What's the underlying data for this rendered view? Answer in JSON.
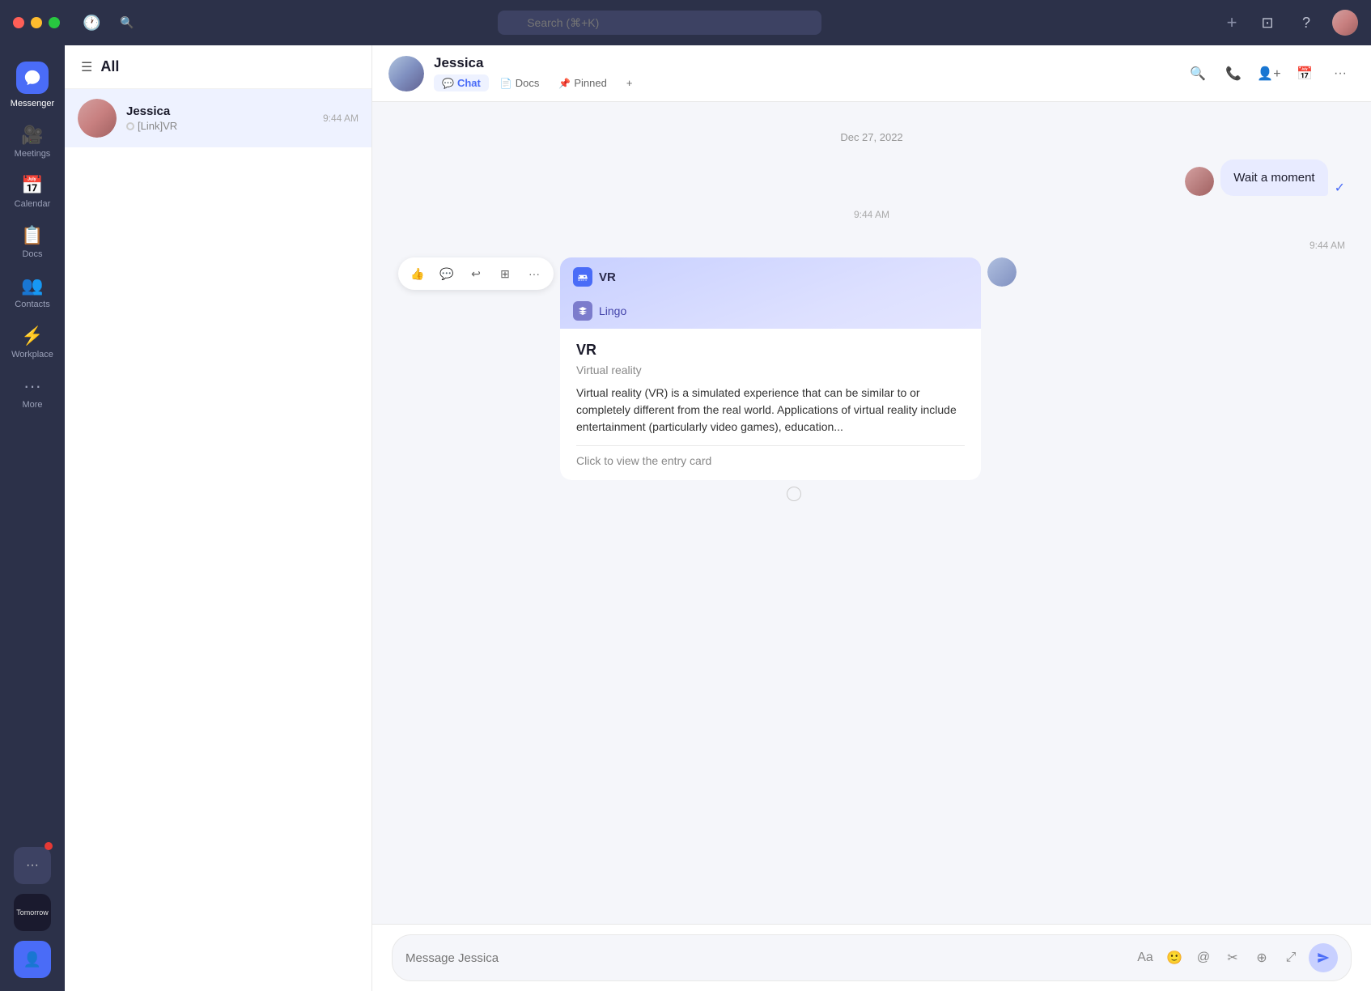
{
  "titlebar": {
    "search_placeholder": "Search (⌘+K)",
    "add_label": "+",
    "icons": [
      "screen-share",
      "help",
      "avatar"
    ]
  },
  "sidebar": {
    "items": [
      {
        "id": "messenger",
        "label": "Messenger",
        "active": true
      },
      {
        "id": "meetings",
        "label": "Meetings"
      },
      {
        "id": "calendar",
        "label": "Calendar"
      },
      {
        "id": "docs",
        "label": "Docs"
      },
      {
        "id": "contacts",
        "label": "Contacts"
      },
      {
        "id": "workplace",
        "label": "Workplace"
      },
      {
        "id": "more",
        "label": "More"
      }
    ]
  },
  "conversations": {
    "header": "All",
    "items": [
      {
        "name": "Jessica",
        "time": "9:44 AM",
        "preview": "[Link]VR"
      }
    ]
  },
  "chat": {
    "contact_name": "Jessica",
    "tabs": [
      {
        "id": "chat",
        "label": "Chat",
        "active": true,
        "icon": "💬"
      },
      {
        "id": "docs",
        "label": "Docs",
        "active": false,
        "icon": "📄"
      },
      {
        "id": "pinned",
        "label": "Pinned",
        "active": false,
        "icon": "📌"
      },
      {
        "id": "add",
        "label": "+",
        "active": false
      }
    ],
    "date_divider": "Dec 27, 2022",
    "messages": [
      {
        "id": "msg1",
        "type": "sent",
        "text": "Wait a moment",
        "time": "9:44 AM"
      },
      {
        "id": "msg2",
        "type": "received",
        "time": "9:44 AM",
        "is_card": true,
        "card": {
          "title": "VR",
          "subtitle": "Lingo",
          "term": "VR",
          "definition": "Virtual reality",
          "description": "Virtual reality (VR) is a simulated experience that can be similar to or completely different from the real world. Applications of virtual reality include entertainment (particularly video games), education...",
          "link": "Click to view the entry card"
        }
      }
    ]
  },
  "input": {
    "placeholder": "Message Jessica"
  },
  "message_actions": {
    "icons": [
      "👍",
      "💬",
      "↩",
      "⊞",
      "···"
    ]
  }
}
